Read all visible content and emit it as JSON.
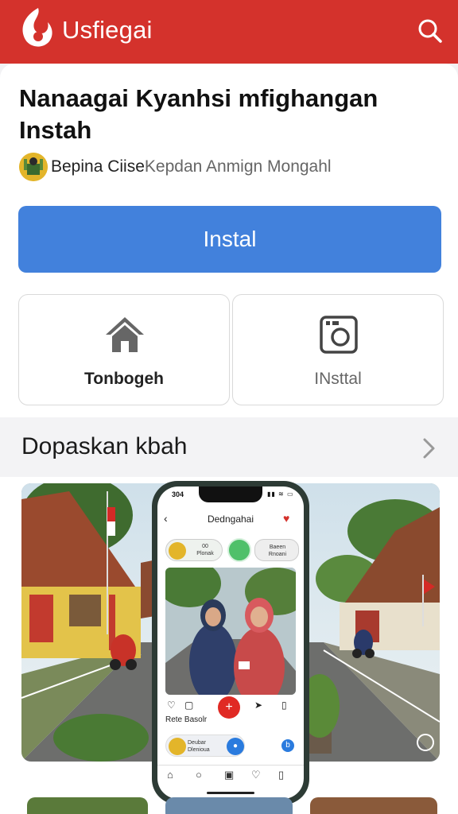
{
  "header": {
    "brand": "Usfiegai",
    "logo_icon": "flame-logo-icon",
    "search_icon": "search-icon",
    "bg_color": "#d4322c"
  },
  "app": {
    "title": "Nanaagai Kyanhsi mfighangan Instah",
    "developer": "Bepina Ciise",
    "developer_sub": "Kepdan Anmign Mongahl"
  },
  "install_button": {
    "label": "Instal",
    "color": "#4281dc"
  },
  "tiles": [
    {
      "label": "Tonbogeh",
      "icon": "home-icon"
    },
    {
      "label": "INsttal",
      "icon": "camera-icon"
    }
  ],
  "section": {
    "title": "Dopaskan kbah"
  },
  "phone": {
    "time": "304",
    "screen_title": "Dedngahai",
    "chip_left": "Plonak",
    "chip_left_top": "00",
    "chip_right_1": "Baeen",
    "chip_right_2": "Rnoani",
    "caption": "Rete Basolr",
    "promo_1": "Deubar",
    "promo_2": "Dlenioua"
  }
}
